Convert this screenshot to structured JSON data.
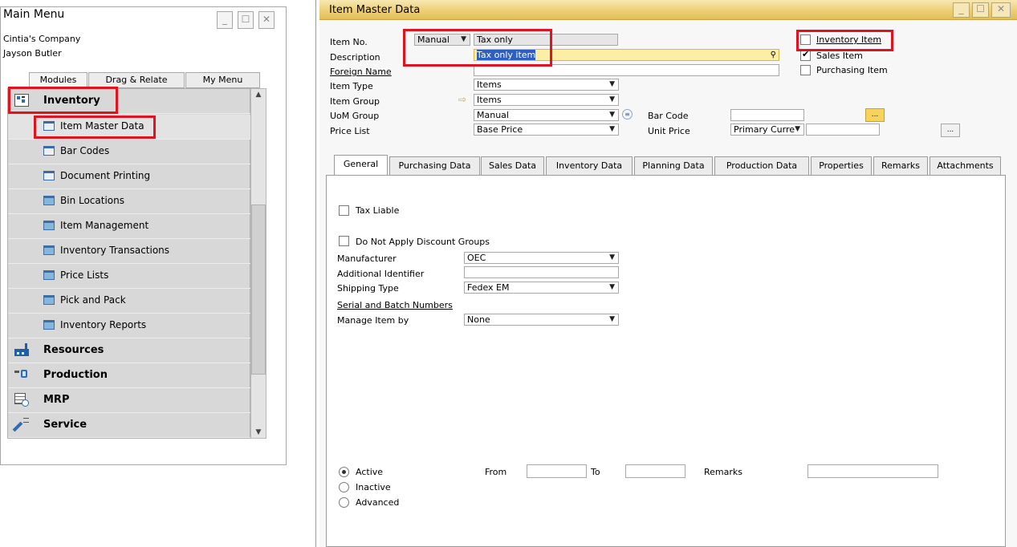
{
  "main_menu": {
    "title": "Main Menu",
    "company": "Cintia's Company",
    "user": "Jayson Butler",
    "window_buttons": [
      "_",
      "☐",
      "✕"
    ],
    "tabs": [
      "Modules",
      "Drag & Relate",
      "My Menu"
    ],
    "modules": [
      {
        "label": "Inventory",
        "icon": "inventory-icon"
      },
      {
        "label": "Resources",
        "icon": "resources-icon"
      },
      {
        "label": "Production",
        "icon": "production-icon"
      },
      {
        "label": "MRP",
        "icon": "mrp-icon"
      },
      {
        "label": "Service",
        "icon": "service-icon"
      }
    ],
    "inventory_items": [
      {
        "label": "Item Master Data",
        "icon": "form-icon"
      },
      {
        "label": "Bar Codes",
        "icon": "form-icon"
      },
      {
        "label": "Document Printing",
        "icon": "form-icon"
      },
      {
        "label": "Bin Locations",
        "icon": "folder-icon"
      },
      {
        "label": "Item Management",
        "icon": "folder-icon"
      },
      {
        "label": "Inventory Transactions",
        "icon": "folder-icon"
      },
      {
        "label": "Price Lists",
        "icon": "folder-icon"
      },
      {
        "label": "Pick and Pack",
        "icon": "folder-icon"
      },
      {
        "label": "Inventory Reports",
        "icon": "folder-icon"
      }
    ]
  },
  "item_master": {
    "title": "Item Master Data",
    "window_buttons": [
      "_",
      "☐",
      "✕"
    ],
    "labels": {
      "item_no": "Item No.",
      "description": "Description",
      "foreign_name": "Foreign Name",
      "item_type": "Item Type",
      "item_group": "Item Group",
      "uom_group": "UoM Group",
      "price_list": "Price List",
      "bar_code": "Bar Code",
      "unit_price": "Unit Price"
    },
    "values": {
      "numbering_series": "Manual",
      "item_no": "Tax only",
      "description": "Tax only item",
      "foreign_name": "",
      "item_type": "Items",
      "item_group": "Items",
      "uom_group": "Manual",
      "price_list": "Base Price",
      "bar_code": "",
      "currency": "Primary Curre",
      "unit_price": ""
    },
    "checkboxes": [
      {
        "label": "Inventory Item",
        "checked": false
      },
      {
        "label": "Sales Item",
        "checked": true
      },
      {
        "label": "Purchasing Item",
        "checked": false
      }
    ],
    "tabs": [
      "General",
      "Purchasing Data",
      "Sales Data",
      "Inventory Data",
      "Planning Data",
      "Production Data",
      "Properties",
      "Remarks",
      "Attachments"
    ],
    "general": {
      "tax_liable": "Tax Liable",
      "no_discount": "Do Not Apply Discount Groups",
      "manufacturer_label": "Manufacturer",
      "manufacturer": "OEC",
      "additional_id_label": "Additional Identifier",
      "additional_id": "",
      "shipping_type_label": "Shipping Type",
      "shipping_type": "Fedex EM",
      "serial_batch": "Serial and Batch Numbers",
      "manage_by_label": "Manage Item by",
      "manage_by": "None",
      "status_options": [
        {
          "label": "Active",
          "selected": true
        },
        {
          "label": "Inactive",
          "selected": false
        },
        {
          "label": "Advanced",
          "selected": false
        }
      ],
      "from_label": "From",
      "to_label": "To",
      "remarks_label": "Remarks"
    },
    "ellipsis": "..."
  },
  "colors": {
    "titlebar": "#edcf75",
    "highlight": "#e0141e",
    "selected_field": "#fdeea5"
  }
}
